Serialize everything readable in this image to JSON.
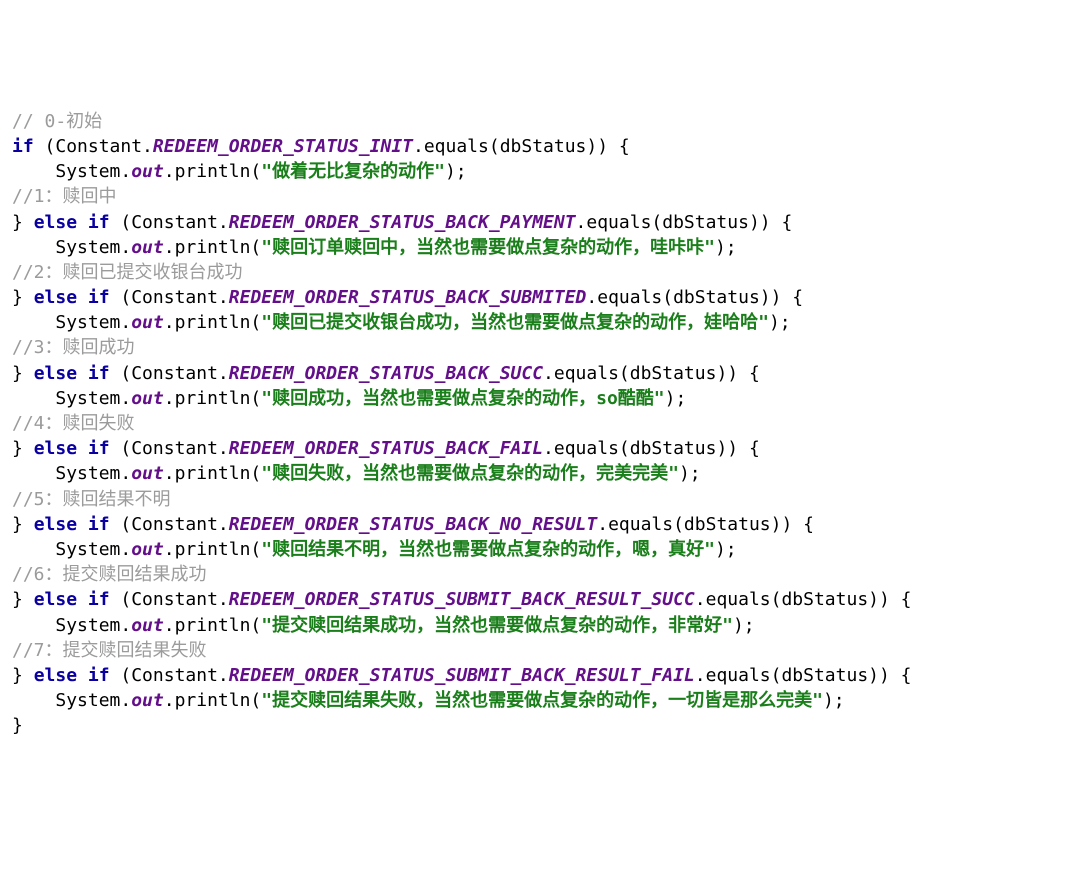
{
  "code": {
    "lines": [
      {
        "indent": 0,
        "parts": [
          {
            "cls": "comment",
            "t": "// 0-初始"
          }
        ]
      },
      {
        "indent": 0,
        "parts": [
          {
            "cls": "kw",
            "t": "if"
          },
          {
            "cls": "plain",
            "t": " (Constant."
          },
          {
            "cls": "field",
            "t": "REDEEM_ORDER_STATUS_INIT"
          },
          {
            "cls": "plain",
            "t": ".equals(dbStatus)) {"
          }
        ]
      },
      {
        "indent": 1,
        "parts": [
          {
            "cls": "plain",
            "t": "System."
          },
          {
            "cls": "field",
            "t": "out"
          },
          {
            "cls": "plain",
            "t": ".println("
          },
          {
            "cls": "str",
            "t": "\"做着无比复杂的动作\""
          },
          {
            "cls": "plain",
            "t": ");"
          }
        ]
      },
      {
        "indent": 0,
        "parts": [
          {
            "cls": "comment",
            "t": "//1：赎回中"
          }
        ]
      },
      {
        "indent": 0,
        "parts": [
          {
            "cls": "plain",
            "t": "} "
          },
          {
            "cls": "kw",
            "t": "else if"
          },
          {
            "cls": "plain",
            "t": " (Constant."
          },
          {
            "cls": "field",
            "t": "REDEEM_ORDER_STATUS_BACK_PAYMENT"
          },
          {
            "cls": "plain",
            "t": ".equals(dbStatus)) {"
          }
        ]
      },
      {
        "indent": 1,
        "parts": [
          {
            "cls": "plain",
            "t": "System."
          },
          {
            "cls": "field",
            "t": "out"
          },
          {
            "cls": "plain",
            "t": ".println("
          },
          {
            "cls": "str",
            "t": "\"赎回订单赎回中，当然也需要做点复杂的动作，哇咔咔\""
          },
          {
            "cls": "plain",
            "t": ");"
          }
        ]
      },
      {
        "indent": 0,
        "parts": [
          {
            "cls": "comment",
            "t": "//2：赎回已提交收银台成功"
          }
        ]
      },
      {
        "indent": 0,
        "parts": [
          {
            "cls": "plain",
            "t": "} "
          },
          {
            "cls": "kw",
            "t": "else if"
          },
          {
            "cls": "plain",
            "t": " (Constant."
          },
          {
            "cls": "field",
            "t": "REDEEM_ORDER_STATUS_BACK_SUBMITED"
          },
          {
            "cls": "plain",
            "t": ".equals(dbStatus)) {"
          }
        ]
      },
      {
        "indent": 1,
        "parts": [
          {
            "cls": "plain",
            "t": "System."
          },
          {
            "cls": "field",
            "t": "out"
          },
          {
            "cls": "plain",
            "t": ".println("
          },
          {
            "cls": "str",
            "t": "\"赎回已提交收银台成功，当然也需要做点复杂的动作，娃哈哈\""
          },
          {
            "cls": "plain",
            "t": ");"
          }
        ]
      },
      {
        "indent": 0,
        "parts": [
          {
            "cls": "comment",
            "t": "//3：赎回成功"
          }
        ]
      },
      {
        "indent": 0,
        "parts": [
          {
            "cls": "plain",
            "t": "} "
          },
          {
            "cls": "kw",
            "t": "else if"
          },
          {
            "cls": "plain",
            "t": " (Constant."
          },
          {
            "cls": "field",
            "t": "REDEEM_ORDER_STATUS_BACK_SUCC"
          },
          {
            "cls": "plain",
            "t": ".equals(dbStatus)) {"
          }
        ]
      },
      {
        "indent": 1,
        "parts": [
          {
            "cls": "plain",
            "t": "System."
          },
          {
            "cls": "field",
            "t": "out"
          },
          {
            "cls": "plain",
            "t": ".println("
          },
          {
            "cls": "str",
            "t": "\"赎回成功，当然也需要做点复杂的动作，so酷酷\""
          },
          {
            "cls": "plain",
            "t": ");"
          }
        ]
      },
      {
        "indent": 0,
        "parts": [
          {
            "cls": "comment",
            "t": "//4：赎回失败"
          }
        ]
      },
      {
        "indent": 0,
        "parts": [
          {
            "cls": "plain",
            "t": "} "
          },
          {
            "cls": "kw",
            "t": "else if"
          },
          {
            "cls": "plain",
            "t": " (Constant."
          },
          {
            "cls": "field",
            "t": "REDEEM_ORDER_STATUS_BACK_FAIL"
          },
          {
            "cls": "plain",
            "t": ".equals(dbStatus)) {"
          }
        ]
      },
      {
        "indent": 1,
        "parts": [
          {
            "cls": "plain",
            "t": "System."
          },
          {
            "cls": "field",
            "t": "out"
          },
          {
            "cls": "plain",
            "t": ".println("
          },
          {
            "cls": "str",
            "t": "\"赎回失败，当然也需要做点复杂的动作，完美完美\""
          },
          {
            "cls": "plain",
            "t": ");"
          }
        ]
      },
      {
        "indent": 0,
        "parts": [
          {
            "cls": "comment",
            "t": "//5：赎回结果不明"
          }
        ]
      },
      {
        "indent": 0,
        "parts": [
          {
            "cls": "plain",
            "t": "} "
          },
          {
            "cls": "kw",
            "t": "else if"
          },
          {
            "cls": "plain",
            "t": " (Constant."
          },
          {
            "cls": "field",
            "t": "REDEEM_ORDER_STATUS_BACK_NO_RESULT"
          },
          {
            "cls": "plain",
            "t": ".equals(dbStatus)) {"
          }
        ]
      },
      {
        "indent": 1,
        "parts": [
          {
            "cls": "plain",
            "t": "System."
          },
          {
            "cls": "field",
            "t": "out"
          },
          {
            "cls": "plain",
            "t": ".println("
          },
          {
            "cls": "str",
            "t": "\"赎回结果不明，当然也需要做点复杂的动作，嗯，真好\""
          },
          {
            "cls": "plain",
            "t": ");"
          }
        ]
      },
      {
        "indent": 0,
        "parts": [
          {
            "cls": "comment",
            "t": "//6：提交赎回结果成功"
          }
        ]
      },
      {
        "indent": 0,
        "parts": [
          {
            "cls": "plain",
            "t": "} "
          },
          {
            "cls": "kw",
            "t": "else if"
          },
          {
            "cls": "plain",
            "t": " (Constant."
          },
          {
            "cls": "field",
            "t": "REDEEM_ORDER_STATUS_SUBMIT_BACK_RESULT_SUCC"
          },
          {
            "cls": "plain",
            "t": ".equals(dbStatus)) {"
          }
        ]
      },
      {
        "indent": 1,
        "parts": [
          {
            "cls": "plain",
            "t": "System."
          },
          {
            "cls": "field",
            "t": "out"
          },
          {
            "cls": "plain",
            "t": ".println("
          },
          {
            "cls": "str",
            "t": "\"提交赎回结果成功，当然也需要做点复杂的动作，非常好\""
          },
          {
            "cls": "plain",
            "t": ");"
          }
        ]
      },
      {
        "indent": 0,
        "parts": [
          {
            "cls": "comment",
            "t": "//7：提交赎回结果失败"
          }
        ]
      },
      {
        "indent": 0,
        "parts": [
          {
            "cls": "plain",
            "t": "} "
          },
          {
            "cls": "kw",
            "t": "else if"
          },
          {
            "cls": "plain",
            "t": " (Constant."
          },
          {
            "cls": "field",
            "t": "REDEEM_ORDER_STATUS_SUBMIT_BACK_RESULT_FAIL"
          },
          {
            "cls": "plain",
            "t": ".equals(dbStatus)) {"
          }
        ]
      },
      {
        "indent": 1,
        "parts": [
          {
            "cls": "plain",
            "t": "System."
          },
          {
            "cls": "field",
            "t": "out"
          },
          {
            "cls": "plain",
            "t": ".println("
          },
          {
            "cls": "str",
            "t": "\"提交赎回结果失败，当然也需要做点复杂的动作，一切皆是那么完美\""
          },
          {
            "cls": "plain",
            "t": ");"
          }
        ]
      },
      {
        "indent": 0,
        "parts": [
          {
            "cls": "plain",
            "t": "}"
          }
        ]
      }
    ]
  }
}
